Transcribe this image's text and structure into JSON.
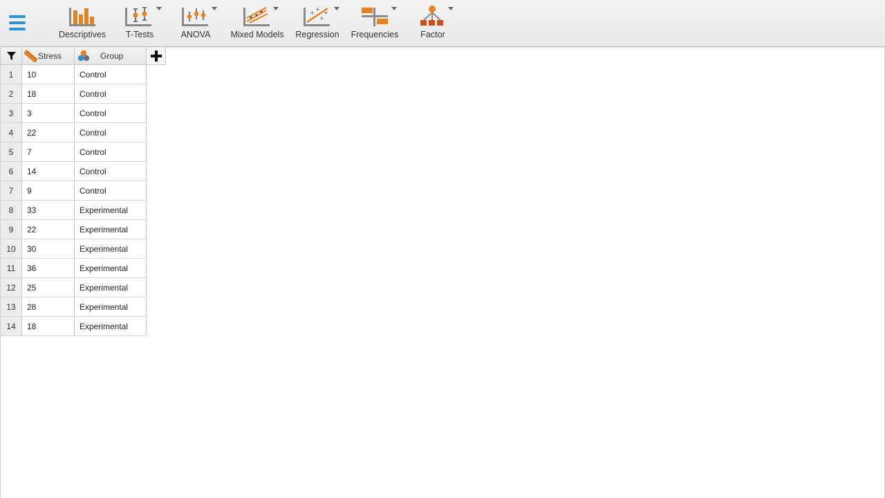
{
  "toolbar": {
    "items": [
      {
        "label": "Descriptives",
        "icon": "descriptives-bar-icon",
        "has_dropdown": false
      },
      {
        "label": "T-Tests",
        "icon": "t-tests-icon",
        "has_dropdown": true
      },
      {
        "label": "ANOVA",
        "icon": "anova-icon",
        "has_dropdown": true
      },
      {
        "label": "Mixed Models",
        "icon": "mixed-models-icon",
        "has_dropdown": true
      },
      {
        "label": "Regression",
        "icon": "regression-icon",
        "has_dropdown": true
      },
      {
        "label": "Frequencies",
        "icon": "frequencies-icon",
        "has_dropdown": true
      },
      {
        "label": "Factor",
        "icon": "factor-icon",
        "has_dropdown": true
      }
    ]
  },
  "grid": {
    "columns": [
      {
        "name": "Stress",
        "icon": "continuous-ruler-icon"
      },
      {
        "name": "Group",
        "icon": "nominal-circles-icon"
      }
    ],
    "rows": [
      {
        "n": "1",
        "stress": "10",
        "group": "Control"
      },
      {
        "n": "2",
        "stress": "18",
        "group": "Control"
      },
      {
        "n": "3",
        "stress": "3",
        "group": "Control"
      },
      {
        "n": "4",
        "stress": "22",
        "group": "Control"
      },
      {
        "n": "5",
        "stress": "7",
        "group": "Control"
      },
      {
        "n": "6",
        "stress": "14",
        "group": "Control"
      },
      {
        "n": "7",
        "stress": "9",
        "group": "Control"
      },
      {
        "n": "8",
        "stress": "33",
        "group": "Experimental"
      },
      {
        "n": "9",
        "stress": "22",
        "group": "Experimental"
      },
      {
        "n": "10",
        "stress": "30",
        "group": "Experimental"
      },
      {
        "n": "11",
        "stress": "36",
        "group": "Experimental"
      },
      {
        "n": "12",
        "stress": "25",
        "group": "Experimental"
      },
      {
        "n": "13",
        "stress": "28",
        "group": "Experimental"
      },
      {
        "n": "14",
        "stress": "18",
        "group": "Experimental"
      }
    ]
  },
  "colors": {
    "accent_orange": "#e8821e",
    "accent_blue": "#2c93d6",
    "icon_gray": "#8a8a8a"
  }
}
